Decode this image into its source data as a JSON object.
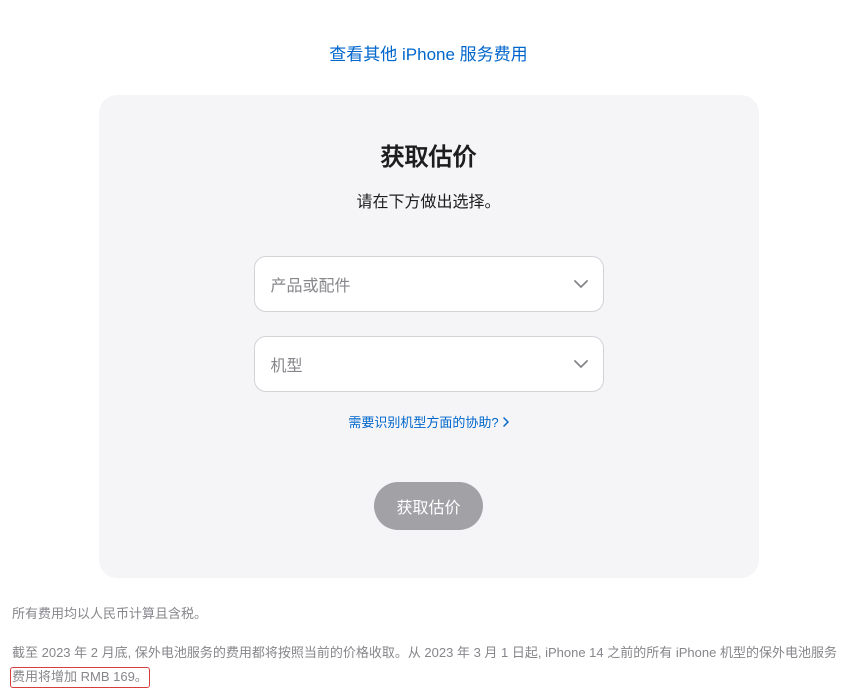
{
  "topLink": "查看其他 iPhone 服务费用",
  "card": {
    "title": "获取估价",
    "subtitle": "请在下方做出选择。",
    "select1": {
      "placeholder": "产品或配件"
    },
    "select2": {
      "placeholder": "机型"
    },
    "helpLink": "需要识别机型方面的协助?",
    "button": "获取估价"
  },
  "disclaimer": {
    "line1": "所有费用均以人民币计算且含税。",
    "line2_part1": "截至 2023 年 2 月底, 保外电池服务的费用都将按照当前的价格收取。从 2023 年 3 月 1 日起, iPhone 14 之前的所有 iPhone 机型的保外电池服务",
    "line2_highlight": "费用将增加 RMB 169。"
  }
}
